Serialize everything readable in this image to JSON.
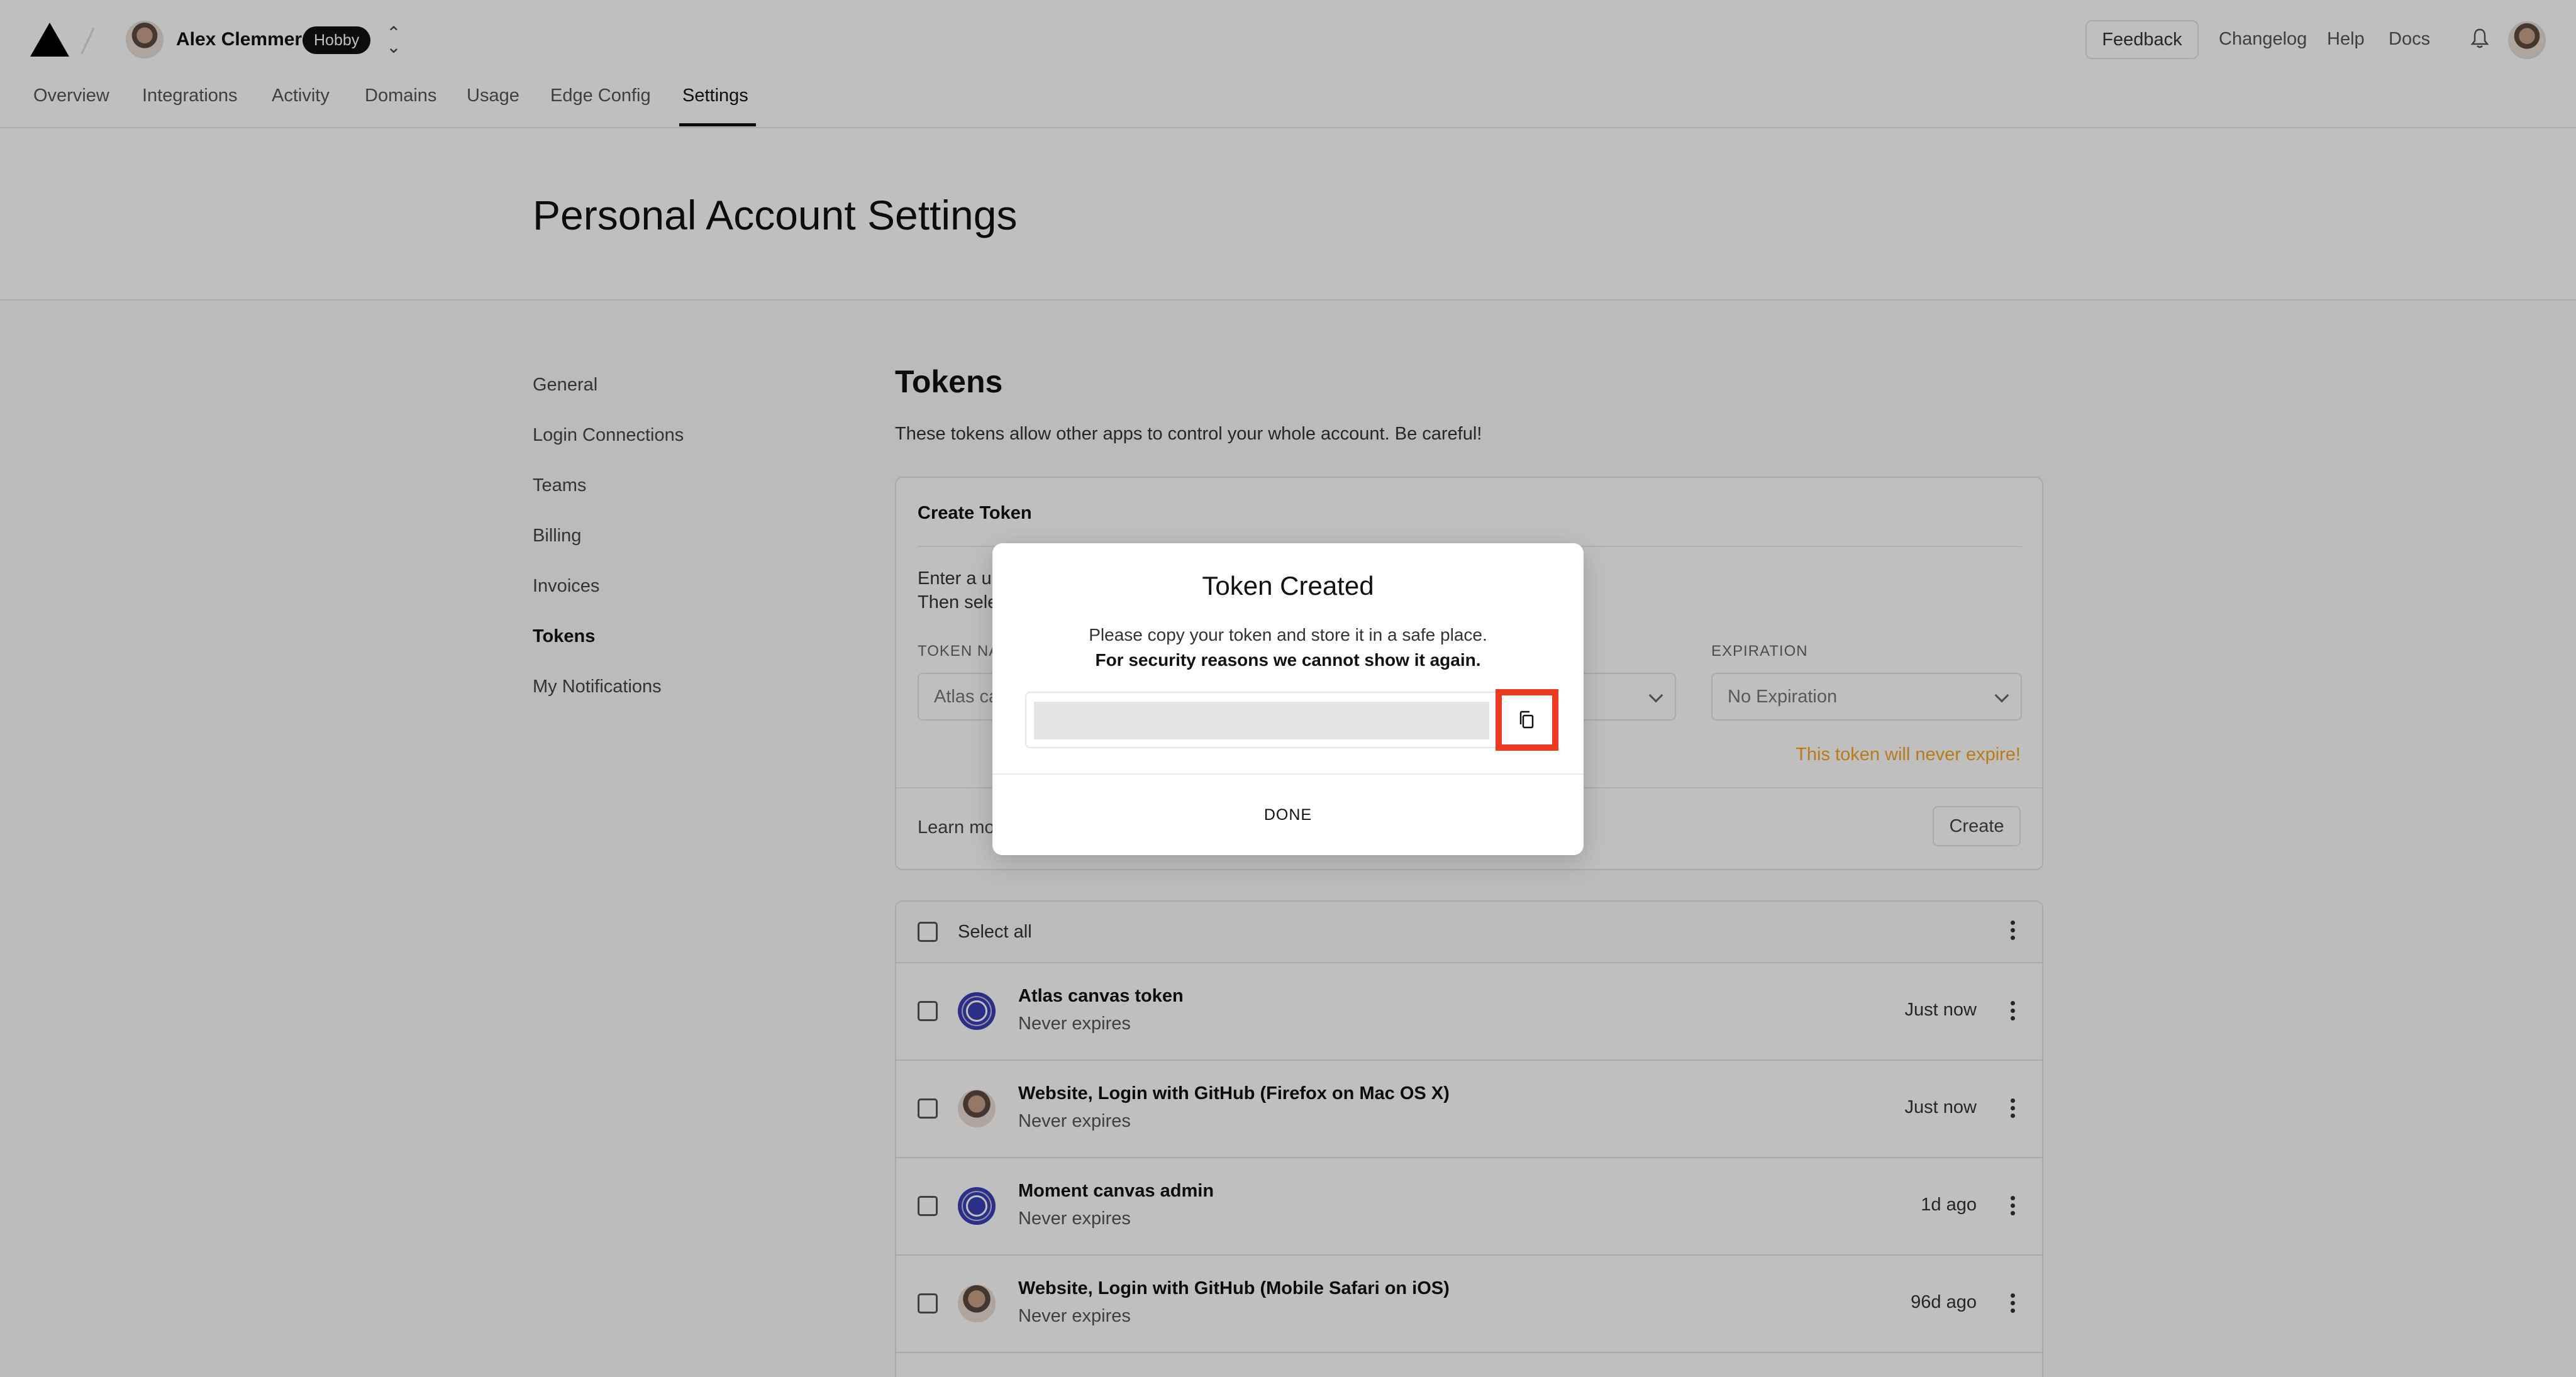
{
  "header": {
    "team_name": "Alex Clemmer",
    "plan_badge": "Hobby",
    "links": {
      "feedback": "Feedback",
      "changelog": "Changelog",
      "help": "Help",
      "docs": "Docs"
    },
    "tabs": [
      {
        "label": "Overview"
      },
      {
        "label": "Integrations"
      },
      {
        "label": "Activity"
      },
      {
        "label": "Domains"
      },
      {
        "label": "Usage"
      },
      {
        "label": "Edge Config"
      },
      {
        "label": "Settings",
        "active": true
      }
    ]
  },
  "page": {
    "title": "Personal Account Settings"
  },
  "sidebar": {
    "items": [
      {
        "label": "General"
      },
      {
        "label": "Login Connections"
      },
      {
        "label": "Teams"
      },
      {
        "label": "Billing"
      },
      {
        "label": "Invoices"
      },
      {
        "label": "Tokens",
        "active": true
      },
      {
        "label": "My Notifications"
      }
    ]
  },
  "tokens_section": {
    "title": "Tokens",
    "description": "These tokens allow other apps to control your whole account. Be careful!",
    "create_card": {
      "title": "Create Token",
      "intro_line1": "Enter a u",
      "intro_line2": "Then sele",
      "token_name_label": "TOKEN NA",
      "token_name_value": "Atlas ca",
      "expiration_label": "EXPIRATION",
      "expiration_value": "No Expiration",
      "warning": "This token will never expire!",
      "learn_more": "Learn mo",
      "create_button": "Create"
    },
    "list": {
      "select_all": "Select all",
      "rows": [
        {
          "name": "Atlas canvas token",
          "expires": "Never expires",
          "time": "Just now",
          "avatar": "app"
        },
        {
          "name": "Website, Login with GitHub (Firefox on Mac OS X)",
          "expires": "Never expires",
          "time": "Just now",
          "avatar": "person"
        },
        {
          "name": "Moment canvas admin",
          "expires": "Never expires",
          "time": "1d ago",
          "avatar": "app"
        },
        {
          "name": "Website, Login with GitHub (Mobile Safari on iOS)",
          "expires": "Never expires",
          "time": "96d ago",
          "avatar": "person"
        }
      ]
    }
  },
  "modal": {
    "title": "Token Created",
    "message": "Please copy your token and store it in a safe place.",
    "message_bold": "For security reasons we cannot show it again.",
    "done_button": "DONE"
  },
  "colors": {
    "highlight": "#ec3a1e",
    "warning": "#f5a623",
    "app_avatar": "#3b3fb6"
  },
  "icons": [
    "logo-triangle",
    "chevron-up-down-icon",
    "bell-icon",
    "chevron-down-icon",
    "kebab-menu-icon",
    "copy-icon"
  ]
}
